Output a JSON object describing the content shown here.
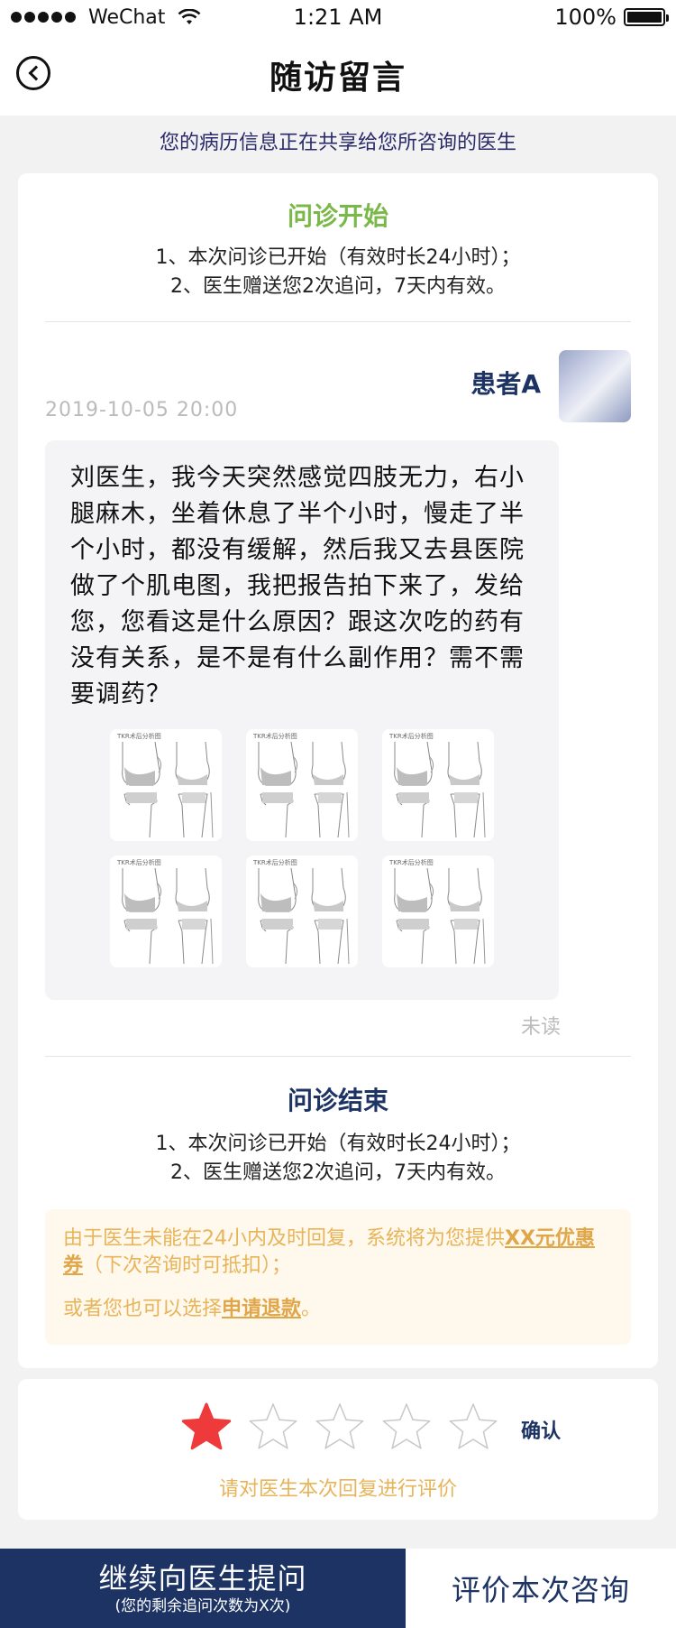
{
  "status_bar": {
    "carrier": "WeChat",
    "time": "1:21 AM",
    "battery": "100%",
    "battery_level": 1.0
  },
  "nav": {
    "title": "随访留言",
    "back_icon": "back-arrow-circle-icon"
  },
  "share_notice": "您的病历信息正在共享给您所咨询的医生",
  "consult_start": {
    "title": "问诊开始",
    "title_color": "#7bb84a",
    "line1": "1、本次问诊已开始（有效时长24小时）；",
    "line2": "2、医生赠送您2次追问，7天内有效。"
  },
  "message": {
    "sender": "患者A",
    "timestamp": "2019-10-05   20:00",
    "text": "刘医生，我今天突然感觉四肢无力，右小腿麻木，坐着休息了半个小时，慢走了半个小时，都没有缓解，然后我又去县医院做了个肌电图，我把报告拍下来了，发给您，您看这是什么原因？跟这次吃的药有没有关系，是不是有什么副作用？需不需要调药？",
    "images": [
      {
        "caption": "TKR术后分析图"
      },
      {
        "caption": "TKR术后分析图"
      },
      {
        "caption": "TKR术后分析图"
      },
      {
        "caption": "TKR术后分析图"
      },
      {
        "caption": "TKR术后分析图"
      },
      {
        "caption": "TKR术后分析图"
      }
    ],
    "read_status": "未读"
  },
  "consult_end": {
    "title": "问诊结束",
    "title_color": "#1c3364",
    "line1": "1、本次问诊已开始（有效时长24小时）；",
    "line2": "2、医生赠送您2次追问，7天内有效。"
  },
  "refund": {
    "text_a": "由于医生未能在24小内及时回复，系统将为您提供",
    "coupon_link": "XX元优惠券",
    "text_b": "（下次咨询时可抵扣）；",
    "text_c": "或者您也可以选择",
    "refund_link": "申请退款",
    "text_d": "。",
    "color": "#e8b45a"
  },
  "rating": {
    "max_stars": 5,
    "selected": 1,
    "active_color": "#ee3a3a",
    "confirm_label": "确认",
    "hint": "请对医生本次回复进行评价"
  },
  "bottom": {
    "ask_label": "继续向医生提问",
    "ask_sub": "(您的剩余追问次数为X次)",
    "rate_label": "评价本次咨询",
    "primary_color": "#1c3364"
  }
}
